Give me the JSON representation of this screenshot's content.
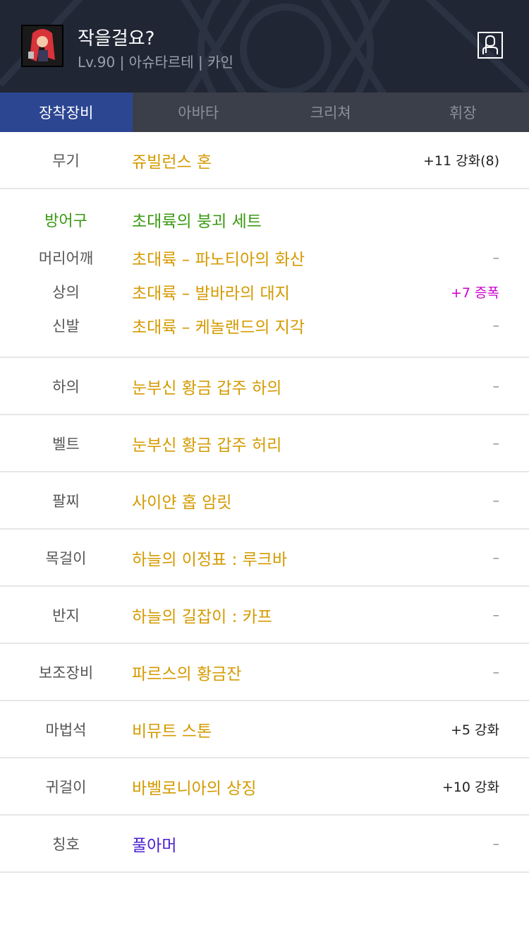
{
  "header": {
    "name": "작을걸요?",
    "info": "Lv.90 | 아슈타르테 | 카인",
    "bg_color": "#202634"
  },
  "tabs": [
    {
      "label": "장착장비",
      "active": true
    },
    {
      "label": "아바타",
      "active": false
    },
    {
      "label": "크리쳐",
      "active": false
    },
    {
      "label": "휘장",
      "active": false
    }
  ],
  "weapon": {
    "label": "무기",
    "item": "쥬빌런스 혼",
    "extra": "+11 강화(8)"
  },
  "armor": {
    "set_label": "방어구",
    "set_name": "초대륙의 붕괴 세트",
    "parts": [
      {
        "label": "머리어깨",
        "item": "초대륙 – 파노티아의 화산",
        "extra": "–"
      },
      {
        "label": "상의",
        "item": "초대륙 – 발바라의 대지",
        "extra": "+7 증폭"
      },
      {
        "label": "신발",
        "item": "초대륙 – 케놀랜드의 지각",
        "extra": "–"
      }
    ]
  },
  "rows": [
    {
      "label": "하의",
      "item": "눈부신 황금 갑주 하의",
      "extra": "–"
    },
    {
      "label": "벨트",
      "item": "눈부신 황금 갑주 허리",
      "extra": "–"
    },
    {
      "label": "팔찌",
      "item": "사이얀 홉 암릿",
      "extra": "–"
    },
    {
      "label": "목걸이",
      "item": "하늘의 이정표 : 루크바",
      "extra": "–"
    },
    {
      "label": "반지",
      "item": "하늘의 길잡이 : 카프",
      "extra": "–"
    },
    {
      "label": "보조장비",
      "item": "파르스의 황금잔",
      "extra": "–"
    },
    {
      "label": "마법석",
      "item": "비뮤트 스톤",
      "extra": "+5 강화"
    },
    {
      "label": "귀걸이",
      "item": "바벨로니아의 상징",
      "extra": "+10 강화"
    },
    {
      "label": "칭호",
      "item": "풀아머",
      "extra": "–"
    }
  ],
  "colors": {
    "item": "#d49a00",
    "set": "#3a9a12",
    "amplify": "#cc00cc",
    "title_item": "#4a20d0",
    "active_tab": "#2c4692"
  }
}
